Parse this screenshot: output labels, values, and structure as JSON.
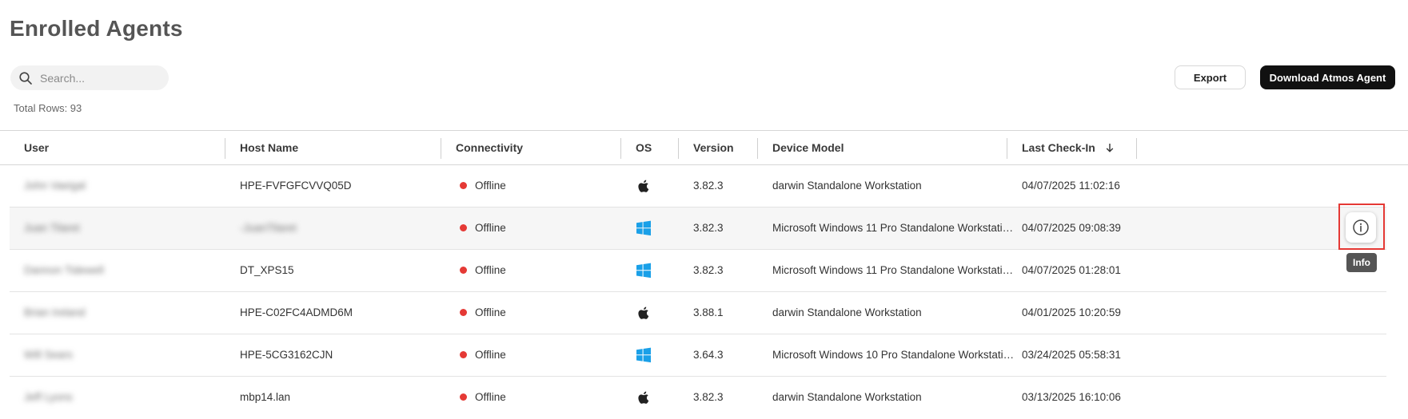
{
  "page": {
    "title": "Enrolled Agents"
  },
  "search": {
    "placeholder": "Search..."
  },
  "summary": {
    "total_rows": "Total Rows: 93"
  },
  "toolbar": {
    "export_label": "Export",
    "download_label": "Download Atmos Agent"
  },
  "table": {
    "columns": {
      "user": "User",
      "host_name": "Host Name",
      "connectivity": "Connectivity",
      "os": "OS",
      "version": "Version",
      "device_model": "Device Model",
      "last_check_in": "Last Check-In"
    },
    "sort": {
      "column": "last_check_in",
      "direction": "descending"
    },
    "rows": [
      {
        "user": "John Vaeigal",
        "host_name": "HPE-FVFGFCVVQ05D",
        "connectivity": "Offline",
        "os": "apple-icon",
        "version": "3.82.3",
        "device_model": "darwin Standalone Workstation",
        "last_check_in": "04/07/2025 11:02:16"
      },
      {
        "user": "Juan Tilaret",
        "host_name": "-JuanTilaret",
        "connectivity": "Offline",
        "os": "windows-icon",
        "version": "3.82.3",
        "device_model": "Microsoft Windows 11 Pro Standalone Workstati…",
        "last_check_in": "04/07/2025 09:08:39"
      },
      {
        "user": "Dannon Tidewell",
        "host_name": "DT_XPS15",
        "connectivity": "Offline",
        "os": "windows-icon",
        "version": "3.82.3",
        "device_model": "Microsoft Windows 11 Pro Standalone Workstati…",
        "last_check_in": "04/07/2025 01:28:01"
      },
      {
        "user": "Brian Ireland",
        "host_name": "HPE-C02FC4ADMD6M",
        "connectivity": "Offline",
        "os": "apple-icon",
        "version": "3.88.1",
        "device_model": "darwin Standalone Workstation",
        "last_check_in": "04/01/2025 10:20:59"
      },
      {
        "user": "Will Sears",
        "host_name": "HPE-5CG3162CJN",
        "connectivity": "Offline",
        "os": "windows-icon",
        "version": "3.64.3",
        "device_model": "Microsoft Windows 10 Pro Standalone Workstati…",
        "last_check_in": "03/24/2025 05:58:31"
      },
      {
        "user": "Jeff Lyons",
        "host_name": "mbp14.lan",
        "connectivity": "Offline",
        "os": "apple-icon",
        "version": "3.82.3",
        "device_model": "darwin Standalone Workstation",
        "last_check_in": "03/13/2025 16:10:06"
      }
    ]
  },
  "row_actions": {
    "info_tooltip": "Info"
  },
  "colors": {
    "offline": "#e53935",
    "windows": "#1aa0e8",
    "primary_button": "#111111",
    "highlight": "#e53935"
  }
}
